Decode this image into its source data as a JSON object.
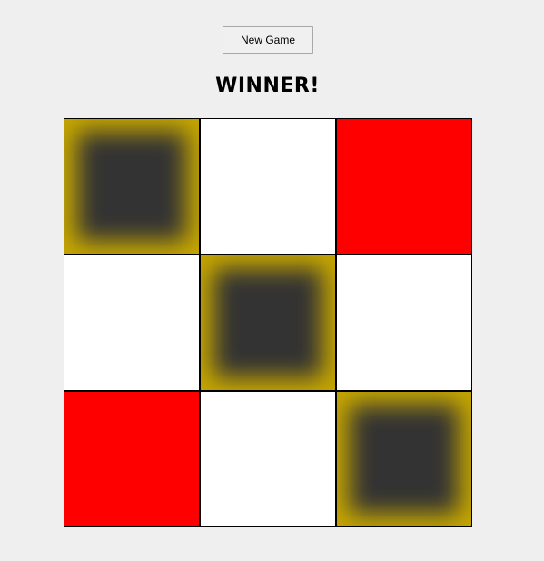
{
  "controls": {
    "new_game_label": "New Game"
  },
  "status": {
    "text": "WINNER!"
  },
  "board": {
    "cells": [
      "winner",
      "empty",
      "red",
      "empty",
      "winner",
      "empty",
      "red",
      "empty",
      "winner"
    ]
  },
  "colors": {
    "background": "#efefef",
    "empty_cell": "#ffffff",
    "red_cell": "#ff0000",
    "winner_center": "#333333",
    "winner_glow": "#c8a800"
  }
}
